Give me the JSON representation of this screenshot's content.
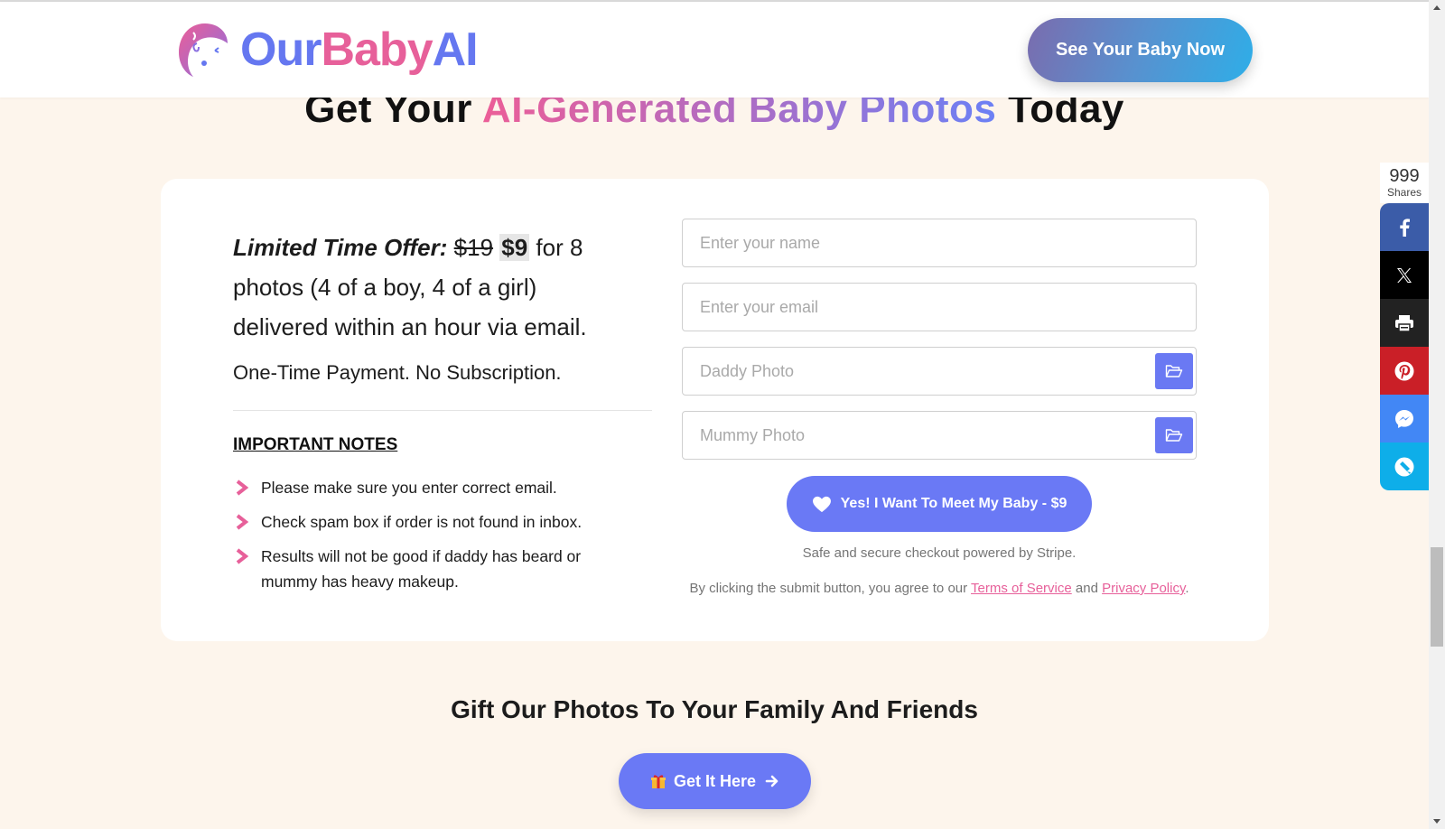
{
  "header": {
    "logo": {
      "part1": "Our",
      "part2": "Baby",
      "part3": "AI",
      "icon": "baby-face-logo-icon"
    },
    "cta_label": "See Your Baby Now"
  },
  "hero": {
    "title_before": "Get Your ",
    "title_highlight": "AI-Generated Baby Photos",
    "title_after": " Today"
  },
  "offer": {
    "label": "Limited Time Offer:",
    "old_price": "$19",
    "new_price": "$9",
    "description": " for 8 photos (4 of a boy, 4 of a girl) delivered within an hour via email.",
    "payment_note": "One-Time Payment. No Subscription."
  },
  "notes": {
    "title": "IMPORTANT NOTES",
    "items": [
      "Please make sure you enter correct email.",
      "Check spam box if order is not found in inbox.",
      "Results will not be good if daddy has beard or mummy has heavy makeup."
    ],
    "bullet_icon": "chevron-right-icon",
    "bullet_color": "#e7609a"
  },
  "form": {
    "name_placeholder": "Enter your name",
    "email_placeholder": "Enter your email",
    "daddy_placeholder": "Daddy Photo",
    "mummy_placeholder": "Mummy Photo",
    "upload_icon": "folder-open-icon",
    "submit_label": "Yes! I Want To Meet My Baby - $9",
    "submit_icon": "heart-icon",
    "secure_text": "Safe and secure checkout powered by Stripe.",
    "agree_prefix": "By clicking the submit button, you agree to our ",
    "terms_label": "Terms of Service",
    "agree_middle": " and ",
    "privacy_label": "Privacy Policy",
    "agree_suffix": "."
  },
  "gift": {
    "title": "Gift Our Photos To Your Family And Friends",
    "button_label": "Get It Here",
    "icons": [
      "gift-icon",
      "arrow-right-icon"
    ]
  },
  "share": {
    "count": "999",
    "count_label": "Shares",
    "buttons": [
      "facebook",
      "x",
      "print",
      "pinterest",
      "messenger",
      "copy-link"
    ]
  },
  "colors": {
    "accent_blue": "#6a79f5",
    "accent_pink": "#e7609a",
    "background": "#fdf5ec"
  }
}
